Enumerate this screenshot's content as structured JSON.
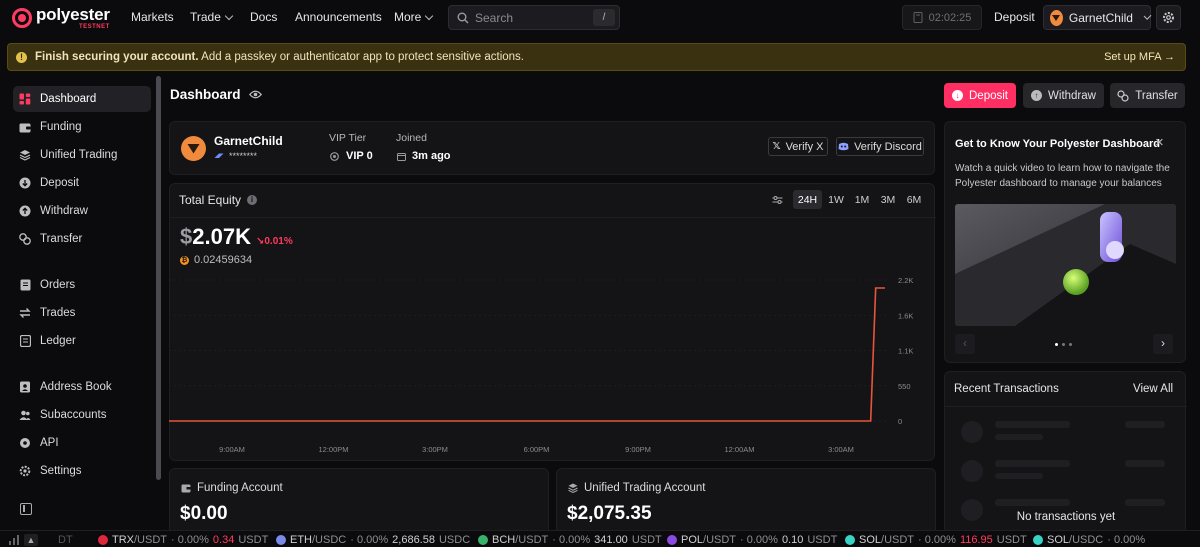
{
  "brand": {
    "name": "polyester",
    "sub": "TESTNET",
    "color": "#ff3b62"
  },
  "nav": {
    "markets": "Markets",
    "trade": "Trade",
    "docs": "Docs",
    "announcements": "Announcements",
    "more": "More",
    "search_placeholder": "Search",
    "search_shortcut": "/",
    "timer": "02:02:25",
    "deposit": "Deposit",
    "username": "GarnetChild"
  },
  "banner": {
    "bold": "Finish securing your account.",
    "text": " Add a passkey or authenticator app to protect sensitive actions.",
    "cta": "Set up MFA →"
  },
  "sidebar": {
    "items": [
      {
        "label": "Dashboard",
        "icon": "grid-icon"
      },
      {
        "label": "Funding",
        "icon": "wallet-icon"
      },
      {
        "label": "Unified Trading",
        "icon": "layers-icon"
      },
      {
        "label": "Deposit",
        "icon": "arrow-down-circle-icon"
      },
      {
        "label": "Withdraw",
        "icon": "arrow-up-circle-icon"
      },
      {
        "label": "Transfer",
        "icon": "transfer-icon"
      },
      {
        "label": "Orders",
        "icon": "document-icon"
      },
      {
        "label": "Trades",
        "icon": "swap-icon"
      },
      {
        "label": "Ledger",
        "icon": "ledger-icon"
      },
      {
        "label": "Address Book",
        "icon": "address-book-icon"
      },
      {
        "label": "Subaccounts",
        "icon": "users-icon"
      },
      {
        "label": "API",
        "icon": "key-icon"
      },
      {
        "label": "Settings",
        "icon": "gear-icon"
      }
    ]
  },
  "main": {
    "title": "Dashboard",
    "actions": {
      "deposit": "Deposit",
      "withdraw": "Withdraw",
      "transfer": "Transfer"
    },
    "profile": {
      "name": "GarnetChild",
      "masked": "********",
      "vip_label": "VIP Tier",
      "vip_value": "VIP 0",
      "joined_label": "Joined",
      "joined_value": "3m ago",
      "verify_x": "Verify X",
      "verify_discord": "Verify Discord"
    },
    "equity": {
      "label": "Total Equity",
      "currency": "$",
      "value": "2.07K",
      "change": "0.01%",
      "btc": "0.02459634",
      "ranges": [
        "24H",
        "1W",
        "1M",
        "3M",
        "6M"
      ],
      "active_range": "24H"
    },
    "funding": {
      "label": "Funding Account",
      "value": "$0.00"
    },
    "unified": {
      "label": "Unified Trading Account",
      "value": "$2,075.35"
    }
  },
  "chart_data": {
    "type": "line",
    "x_ticks": [
      "9:00AM",
      "12:00PM",
      "3:00PM",
      "6:00PM",
      "9:00PM",
      "12:00AM",
      "3:00AM"
    ],
    "y_ticks": [
      "2.2K",
      "1.6K",
      "1.1K",
      "550",
      "0"
    ],
    "ylim": [
      0,
      2200
    ],
    "series": [
      {
        "x": [
          0,
          0.98,
          0.987,
          1.0
        ],
        "values": [
          0,
          0,
          2075,
          2075
        ]
      }
    ],
    "line_color": "#e8553b",
    "grid": true
  },
  "side_panel": {
    "title": "Get to Know Your Polyester Dashboard",
    "body": "Watch a quick video to learn how to navigate the Polyester dashboard to manage your balances",
    "recent_title": "Recent Transactions",
    "view_all": "View All",
    "empty": "No transactions yet"
  },
  "ticker": [
    {
      "base": "DT",
      "quote": "",
      "pct": "",
      "price": "",
      "unit": "",
      "color": "#555"
    },
    {
      "base": "TRX",
      "quote": "/USDT",
      "pct": "· 0.00%",
      "price": "0.34",
      "unit": "USDT",
      "color": "#e0283c",
      "price_red": true
    },
    {
      "base": "ETH",
      "quote": "/USDC",
      "pct": "· 0.00%",
      "price": "2,686.58",
      "unit": "USDC",
      "color": "#7b8be8",
      "price_red": false
    },
    {
      "base": "BCH",
      "quote": "/USDT",
      "pct": "· 0.00%",
      "price": "341.00",
      "unit": "USDT",
      "color": "#37b36b",
      "price_red": false
    },
    {
      "base": "POL",
      "quote": "/USDT",
      "pct": "· 0.00%",
      "price": "0.10",
      "unit": "USDT",
      "color": "#8c4be0",
      "price_red": false
    },
    {
      "base": "SOL",
      "quote": "/USDT",
      "pct": "· 0.00%",
      "price": "116.95",
      "unit": "USDT",
      "color": "#3ad1c6",
      "price_red": true
    },
    {
      "base": "SOL",
      "quote": "/USDC",
      "pct": "· 0.00%",
      "price": "",
      "unit": "",
      "color": "#3ad1c6",
      "price_red": false
    }
  ]
}
